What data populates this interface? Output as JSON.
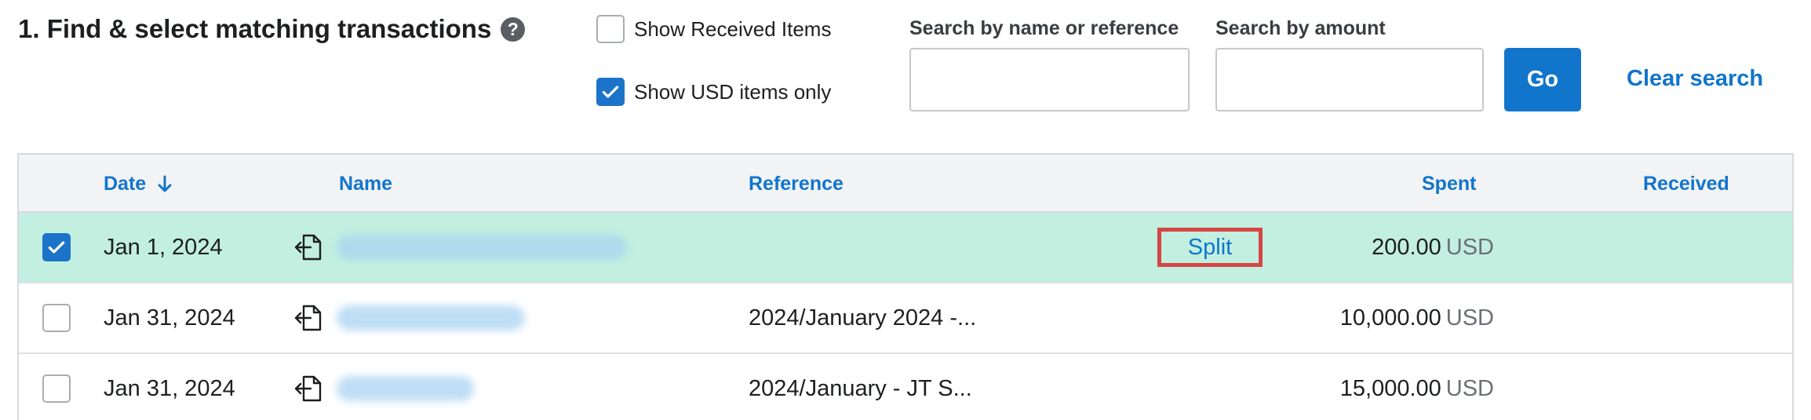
{
  "header": {
    "title": "1. Find & select matching transactions",
    "help_glyph": "?"
  },
  "filters": {
    "show_received_label": "Show Received Items",
    "show_received_checked": false,
    "show_usd_label": "Show USD items only",
    "show_usd_checked": true
  },
  "search": {
    "name_label": "Search by name or reference",
    "name_value": "",
    "amount_label": "Search by amount",
    "amount_value": "",
    "go_label": "Go",
    "clear_label": "Clear search"
  },
  "table": {
    "columns": {
      "date": "Date",
      "name": "Name",
      "reference": "Reference",
      "spent": "Spent",
      "received": "Received"
    },
    "sort_icon": "arrow-down-icon",
    "rows": [
      {
        "checked": true,
        "date": "Jan 1, 2024",
        "reference": "",
        "action": "Split",
        "spent": "200.00",
        "currency": "USD",
        "received": ""
      },
      {
        "checked": false,
        "date": "Jan 31, 2024",
        "reference": "2024/January 2024 -...",
        "action": "",
        "spent": "10,000.00",
        "currency": "USD",
        "received": ""
      },
      {
        "checked": false,
        "date": "Jan 31, 2024",
        "reference": "2024/January - JT S...",
        "action": "",
        "spent": "15,000.00",
        "currency": "USD",
        "received": ""
      }
    ]
  },
  "colors": {
    "accent": "#1175cc",
    "selected_row": "#c2efdf",
    "highlight_border": "#d64545"
  }
}
